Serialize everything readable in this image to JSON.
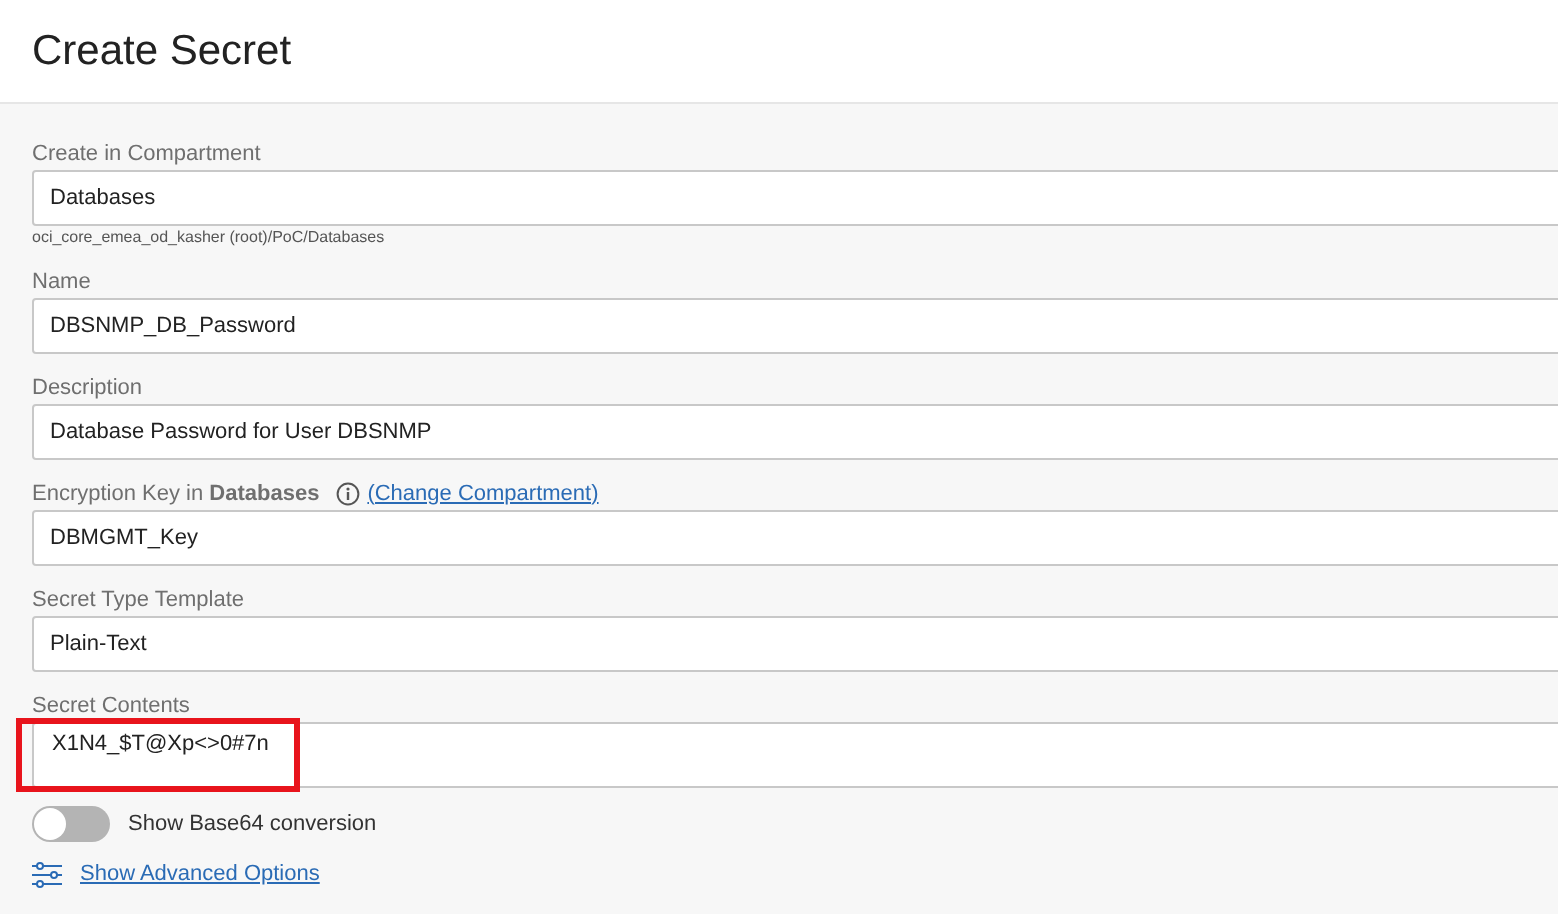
{
  "title": "Create Secret",
  "fields": [
    {
      "kind": "text",
      "label": "Create in Compartment",
      "value": "Databases",
      "hint": "oci_core_emea_od_kasher (root)/PoC/Databases"
    },
    {
      "kind": "text",
      "label": "Name",
      "value": "DBSNMP_DB_Password"
    },
    {
      "kind": "text",
      "label": "Description",
      "value": "Database Password for User DBSNMP"
    },
    {
      "kind": "text",
      "label": "Encryption Key in **Databases**",
      "value": "DBMGMT_Key",
      "info": true,
      "link": "(Change Compartment)"
    },
    {
      "kind": "text",
      "label": "Secret Type Template",
      "value": "Plain-Text"
    },
    {
      "kind": "textarea",
      "label": "Secret Contents",
      "value": "X1N4_$T@Xp<>0#7n",
      "highlighted": true
    }
  ],
  "toggle": {
    "label": "Show Base64 conversion",
    "on": false
  },
  "advanced_link": "Show Advanced Options"
}
